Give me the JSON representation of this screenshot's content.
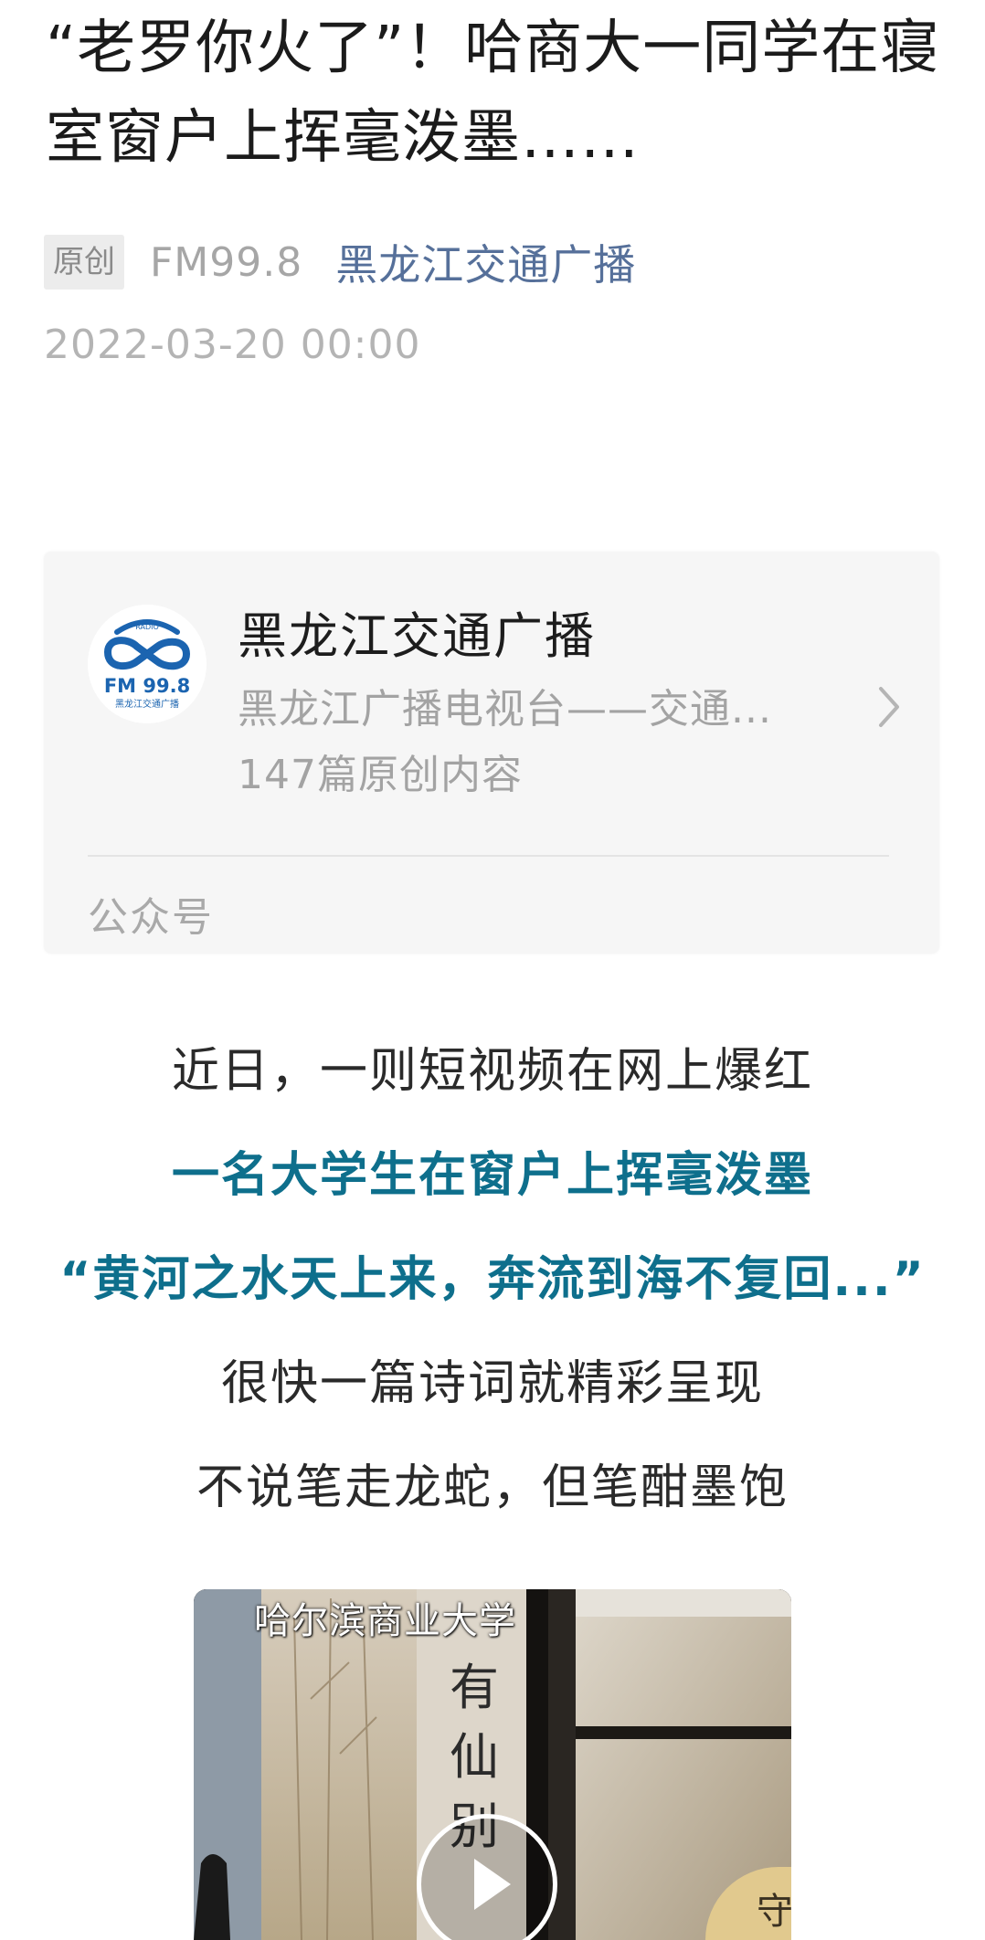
{
  "article": {
    "title": "“老罗你火了”！哈商大一同学在寝室窗户上挥毫泼墨……",
    "original_badge": "原创",
    "station": "FM99.8",
    "account_name": "黑龙江交通广播",
    "date": "2022-03-20 00:00"
  },
  "account_card": {
    "name": "黑龙江交通广播",
    "description": "黑龙江广播电视台——交通...",
    "article_count": "147篇原创内容",
    "type_label": "公众号",
    "logo": {
      "radio_text": "RADIO",
      "station_text": "FM 99.8",
      "sub_text": "黑龙江交通广播"
    }
  },
  "body": {
    "lines": [
      "近日，一则短视频在网上爆红",
      "一名大学生在窗户上挥毫泼墨",
      "“黄河之水天上来，奔流到海不复回...”",
      "很快一篇诗词就精彩呈现",
      "不说笔走龙蛇，但笔酣墨饱"
    ]
  },
  "video": {
    "caption": "哈尔滨商业大学",
    "window_chars": "有仙别",
    "window_right_char": "守"
  },
  "colors": {
    "accent": "#0e6f8c",
    "account_link": "#56709a",
    "logo_blue": "#1b64b0"
  },
  "icons": {
    "chevron": "chevron-right-icon",
    "play": "play-icon"
  }
}
